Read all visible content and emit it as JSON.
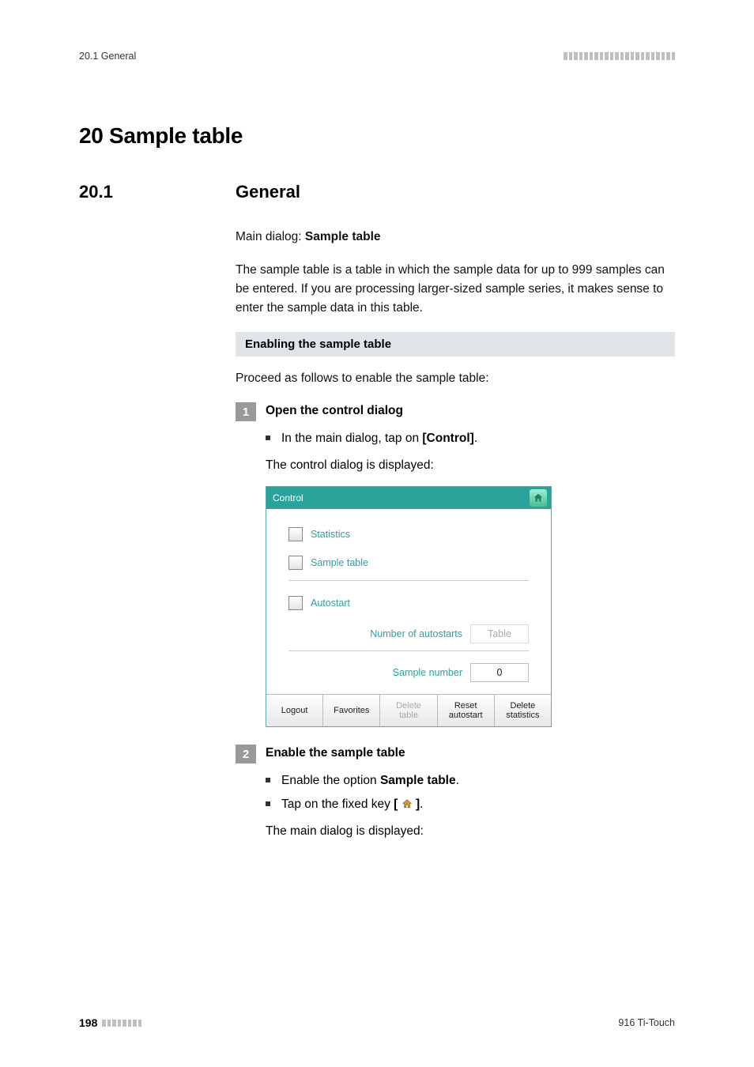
{
  "header": {
    "section_ref": "20.1 General"
  },
  "chapter": {
    "title": "20 Sample table"
  },
  "section": {
    "number": "20.1",
    "title": "General"
  },
  "body": {
    "main_dialog_prefix": "Main dialog: ",
    "main_dialog_label": "Sample table",
    "intro": "The sample table is a table in which the sample data for up to 999 samples can be entered. If you are processing larger-sized sample series, it makes sense to enter the sample data in this table.",
    "note_heading": "Enabling the sample table",
    "note_intro": "Proceed as follows to enable the sample table:"
  },
  "steps": [
    {
      "num": "1",
      "title": "Open the control dialog",
      "bullets": [
        {
          "prefix": "In the main dialog, tap on ",
          "bold": "[Control]",
          "suffix": "."
        }
      ],
      "after": "The control dialog is displayed:"
    },
    {
      "num": "2",
      "title": "Enable the sample table",
      "bullets": [
        {
          "prefix": "Enable the option ",
          "bold": "Sample table",
          "suffix": "."
        },
        {
          "prefix": "Tap on the fixed key ",
          "bold_key": true,
          "suffix": "."
        }
      ],
      "after": "The main dialog is displayed:"
    }
  ],
  "control_dialog": {
    "title": "Control",
    "options": {
      "statistics": "Statistics",
      "sample_table": "Sample table",
      "autostart": "Autostart"
    },
    "fields": {
      "num_autostarts_label": "Number of autostarts",
      "num_autostarts_value": "Table",
      "sample_number_label": "Sample number",
      "sample_number_value": "0"
    },
    "buttons": {
      "logout": "Logout",
      "favorites": "Favorites",
      "delete_table": "Delete\ntable",
      "reset_autostart": "Reset\nautostart",
      "delete_statistics": "Delete\nstatistics"
    }
  },
  "footer": {
    "page": "198",
    "product": "916 Ti-Touch"
  }
}
